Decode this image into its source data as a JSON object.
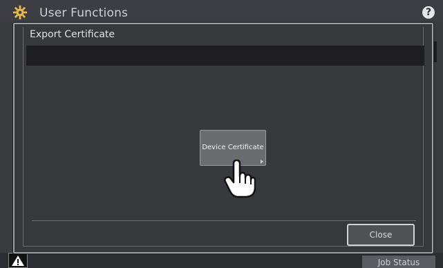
{
  "app": {
    "title": "User Functions",
    "help_icon": "question-mark-icon",
    "help_label": "?"
  },
  "dialog": {
    "title": "Export Certificate",
    "options": [
      {
        "label": "Device Certificate"
      }
    ],
    "close_label": "Close"
  },
  "footer": {
    "job_status_label": "Job Status",
    "warning_icon": "warning-icon"
  },
  "colors": {
    "background": "#3a3b3f",
    "dialog": "#37383c",
    "button": "#6b6c70"
  }
}
